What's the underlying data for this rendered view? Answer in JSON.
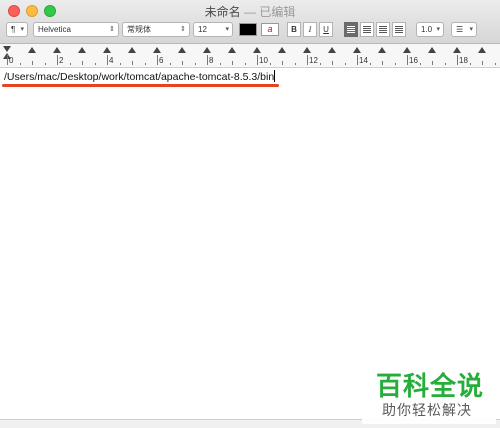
{
  "window": {
    "title": "未命名",
    "title_separator": "—",
    "status": "已编辑"
  },
  "toolbar": {
    "paragraph_style": "¶",
    "font_family": "Helvetica",
    "font_style": "常规体",
    "font_size": "12",
    "text_color": "#000000",
    "highlight_glyph": "a",
    "bold_label": "B",
    "italic_label": "I",
    "underline_label": "U",
    "line_spacing": "1.0",
    "list_glyph": "☰"
  },
  "ruler": {
    "labels": [
      "0",
      "2",
      "4",
      "6",
      "8",
      "10",
      "12",
      "14",
      "16",
      "18"
    ]
  },
  "document": {
    "text": "/Users/mac/Desktop/work/tomcat/apache-tomcat-8.5.3/bin"
  },
  "watermark": {
    "brand": "百科全说",
    "tagline": "助你轻松解决"
  }
}
